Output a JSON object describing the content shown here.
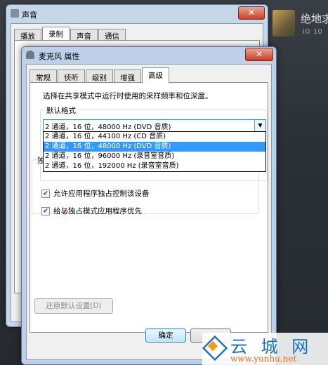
{
  "background_app": {
    "title": "绝地求",
    "id_label": "ID",
    "id_value": "10"
  },
  "sound_window": {
    "title": "声音",
    "close": "✕",
    "tabs": [
      "播放",
      "录制",
      "声音",
      "通信"
    ],
    "active_tab": "录制"
  },
  "mic_window": {
    "title": "麦克风 属性",
    "close": "✕",
    "tabs": [
      "常规",
      "侦听",
      "级别",
      "增强",
      "高级"
    ],
    "active_tab": "高级",
    "default_format": {
      "group_label": "默认格式",
      "description": "选择在共享模式中运行时使用的采样频率和位深度。",
      "selected": "2 通道，16 位，48000 Hz (DVD 音质)",
      "options": [
        "2 通道，16 位，44100 Hz (CD 音质)",
        "2 通道，16 位，48000 Hz (DVD 音质)",
        "2 通道，16 位，96000 Hz (录音室音质)",
        "2 通道，16 位，192000 Hz (录音室音质)"
      ],
      "highlighted_index": 1
    },
    "exclusive_mode": {
      "label": "独",
      "checkboxes": [
        {
          "label": "允许应用程序独占控制该设备",
          "checked": true
        },
        {
          "label": "给与独占模式应用程序优先",
          "checked": true
        }
      ]
    },
    "restore_button": "还原默认设置(D)",
    "ok_button": "确定"
  },
  "watermark": {
    "text": "云 城 网",
    "url": "www.yunhu.net"
  }
}
